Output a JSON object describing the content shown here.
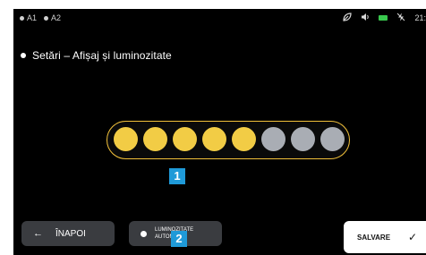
{
  "status": {
    "items": [
      "A1",
      "A2"
    ],
    "time": "21:"
  },
  "page": {
    "title": "Setări – Afișaj și luminozitate"
  },
  "brightness": {
    "level": 5,
    "max": 8,
    "active_color": "#f2cc45",
    "inactive_color": "#a9adb4"
  },
  "badges": [
    "1",
    "2"
  ],
  "buttons": {
    "back": {
      "icon": "arrow-left-icon",
      "label": "ÎNAPOI"
    },
    "auto": {
      "icon": "bullet-icon",
      "label": "LUMINOZITATE AUTOMATĂ"
    },
    "save": {
      "icon": "check-icon",
      "label": "SALVARE"
    }
  },
  "icons": {
    "status": [
      "leaf-icon",
      "speaker-icon",
      "battery-icon",
      "bolt-off-icon"
    ]
  },
  "colors": {
    "accent": "#f2c13a",
    "badge": "#1f9ad8",
    "background": "#000000"
  }
}
